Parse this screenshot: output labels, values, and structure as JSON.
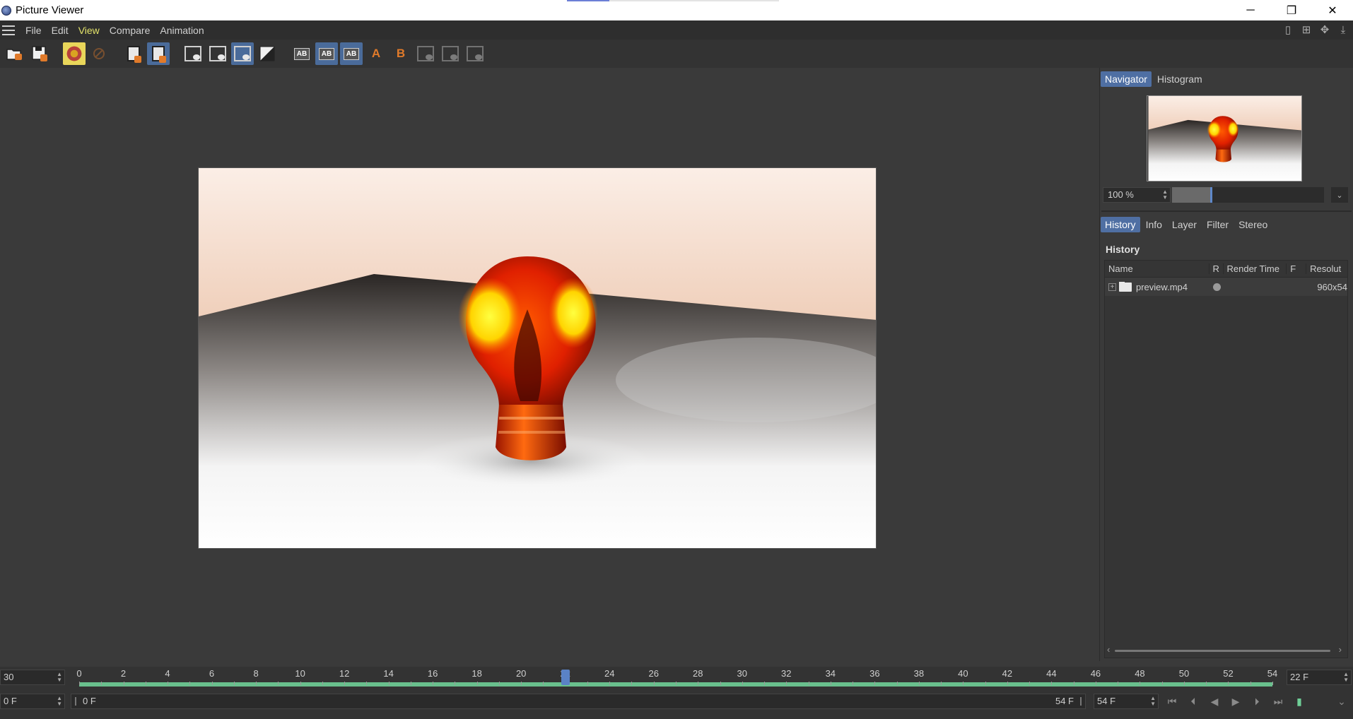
{
  "window": {
    "title": "Picture Viewer",
    "minimize": "─",
    "restore": "❐",
    "close": "✕"
  },
  "menu": {
    "items": [
      "File",
      "Edit",
      "View",
      "Compare",
      "Animation"
    ],
    "active": "View"
  },
  "navigator": {
    "tabs": [
      "Navigator",
      "Histogram"
    ],
    "active_tab": "Navigator",
    "zoom_value": "100 %",
    "zoom_slider_level": 0.26
  },
  "history_panel": {
    "tabs": [
      "History",
      "Info",
      "Layer",
      "Filter",
      "Stereo"
    ],
    "active_tab": "History",
    "title": "History",
    "columns": [
      "Name",
      "R",
      "Render Time",
      "F",
      "Resolut"
    ],
    "rows": [
      {
        "expand": "+",
        "name": "preview.mp4",
        "render_time": "",
        "frame": "",
        "resolution": "960x54"
      }
    ]
  },
  "timeline": {
    "fps": "30",
    "start_frame_field": "0 F",
    "current_frame_field": "22 F",
    "tick_labels": [
      "0",
      "2",
      "4",
      "6",
      "8",
      "10",
      "12",
      "14",
      "16",
      "18",
      "20",
      "22",
      "24",
      "26",
      "28",
      "30",
      "32",
      "34",
      "36",
      "38",
      "40",
      "42",
      "44",
      "46",
      "48",
      "50",
      "52",
      "54"
    ],
    "current_frame": 22,
    "range_start": "0 F",
    "range_end": "54 F",
    "end_frame_field": "54 F"
  },
  "colors": {
    "accent_blue": "#4f6fa3",
    "active_menu": "#e3e36a",
    "timeline_green": "#6fcf97"
  }
}
